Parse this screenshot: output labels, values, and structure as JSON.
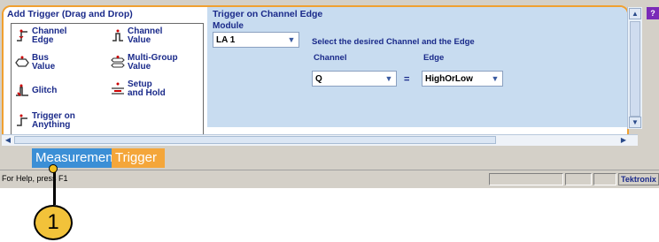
{
  "add_trigger": {
    "title": "Add Trigger (Drag and Drop)",
    "items": [
      {
        "label": "Channel\nEdge",
        "icon": "channel-edge-icon"
      },
      {
        "label": "Channel\nValue",
        "icon": "channel-value-icon"
      },
      {
        "label": "Bus\nValue",
        "icon": "bus-value-icon"
      },
      {
        "label": "Multi-Group\nValue",
        "icon": "multi-group-value-icon"
      },
      {
        "label": "Glitch",
        "icon": "glitch-icon"
      },
      {
        "label": "Setup\nand Hold",
        "icon": "setup-hold-icon"
      },
      {
        "label": "Trigger on\nAnything",
        "icon": "trigger-anything-icon"
      }
    ]
  },
  "channel_edge": {
    "title": "Trigger on Channel Edge",
    "module_label": "Module",
    "module_value": "LA 1",
    "description": "Select the desired Channel and the Edge",
    "channel_label": "Channel",
    "channel_value": "Q",
    "equals": "=",
    "edge_label": "Edge",
    "edge_value": "HighOrLow"
  },
  "tabs": [
    {
      "label": "Measurements"
    },
    {
      "label": "Trigger"
    }
  ],
  "status": {
    "help_text": "For Help, press F1",
    "brand": "Tektronix"
  },
  "callout": {
    "number": "1"
  },
  "colors": {
    "panel_border": "#f0a030",
    "right_pane_bg": "#c8dcf0",
    "tab_measurements": "#3b8fd6",
    "tab_trigger": "#f4a63a",
    "callout_fill": "#f2c23a"
  }
}
